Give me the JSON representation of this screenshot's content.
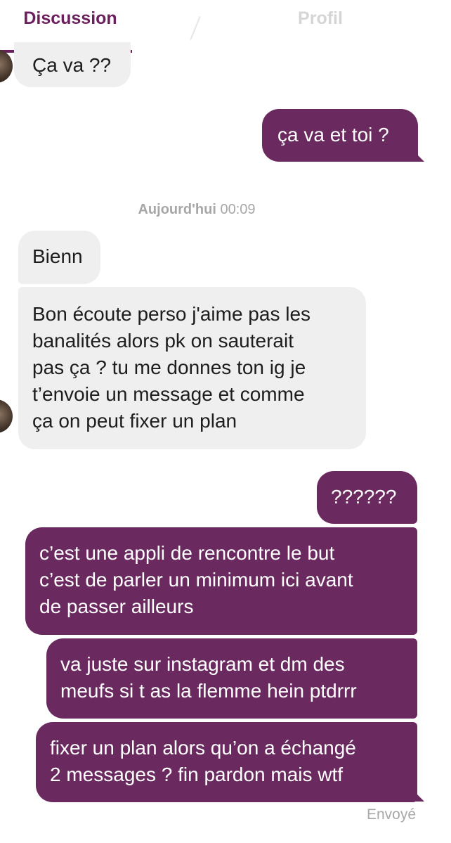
{
  "tabs": {
    "discussion": "Discussion",
    "profil": "Profil"
  },
  "timestamp": {
    "day": "Aujourd'hui",
    "time": "00:09"
  },
  "messages": [
    {
      "text": "Ça va ??"
    },
    {
      "text": "ça va et toi ?"
    },
    {
      "text": "Bienn"
    },
    {
      "text": "Bon écoute perso j'aime pas les\nbanalités alors pk on sauterait\npas ça ? tu me donnes ton ig je\nt’envoie un message et comme\nça on peut fixer un plan"
    },
    {
      "text": "??????"
    },
    {
      "text": "c’est une appli de rencontre le but\nc’est de parler un minimum ici avant\nde passer ailleurs"
    },
    {
      "text": "va juste sur instagram et dm des\nmeufs si t as la flemme hein ptdrrr"
    },
    {
      "text": "fixer un plan alors qu’on a échangé\n2 messages ? fin pardon mais wtf"
    }
  ],
  "status": {
    "sent": "Envoyé"
  },
  "colors": {
    "accent": "#6b1f5d",
    "outgoing_bubble": "#6b2a5f",
    "incoming_bubble": "#efefef"
  }
}
